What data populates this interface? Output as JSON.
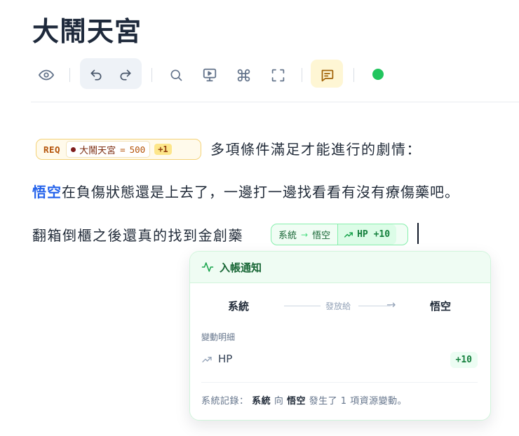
{
  "page": {
    "title": "大鬧天宮"
  },
  "toolbar": {
    "items": [
      "eye-icon",
      "undo-icon",
      "redo-icon",
      "search-icon",
      "present-icon",
      "command-icon",
      "fullscreen-icon",
      "comment-icon",
      "status-dot"
    ],
    "status_color": "#22c55e"
  },
  "content": {
    "req_chip": {
      "label": "REQ",
      "name": "大鬧天宮",
      "eq": "=",
      "value": "500",
      "extra": "+1"
    },
    "line1": "多項條件滿足才能進行的劇情：",
    "line2_hero": "悟空",
    "line2_rest": "在負傷狀態還是上去了，一邊打一邊找看看有沒有療傷藥吧。",
    "line3": "翻箱倒櫃之後還真的找到金創藥",
    "tx_chip": {
      "from": "系統",
      "arrow": "→",
      "to": "悟空",
      "delta": "HP +10"
    }
  },
  "popover": {
    "title": "入帳通知",
    "from": "系統",
    "via": "發放給",
    "to": "悟空",
    "details_label": "變動明細",
    "item_name": "HP",
    "item_delta": "+10",
    "log_prefix": "系統記錄：",
    "log_from": "系統",
    "log_mid": "向",
    "log_to": "悟空",
    "log_suffix": "發生了 1 項資源變動。"
  }
}
